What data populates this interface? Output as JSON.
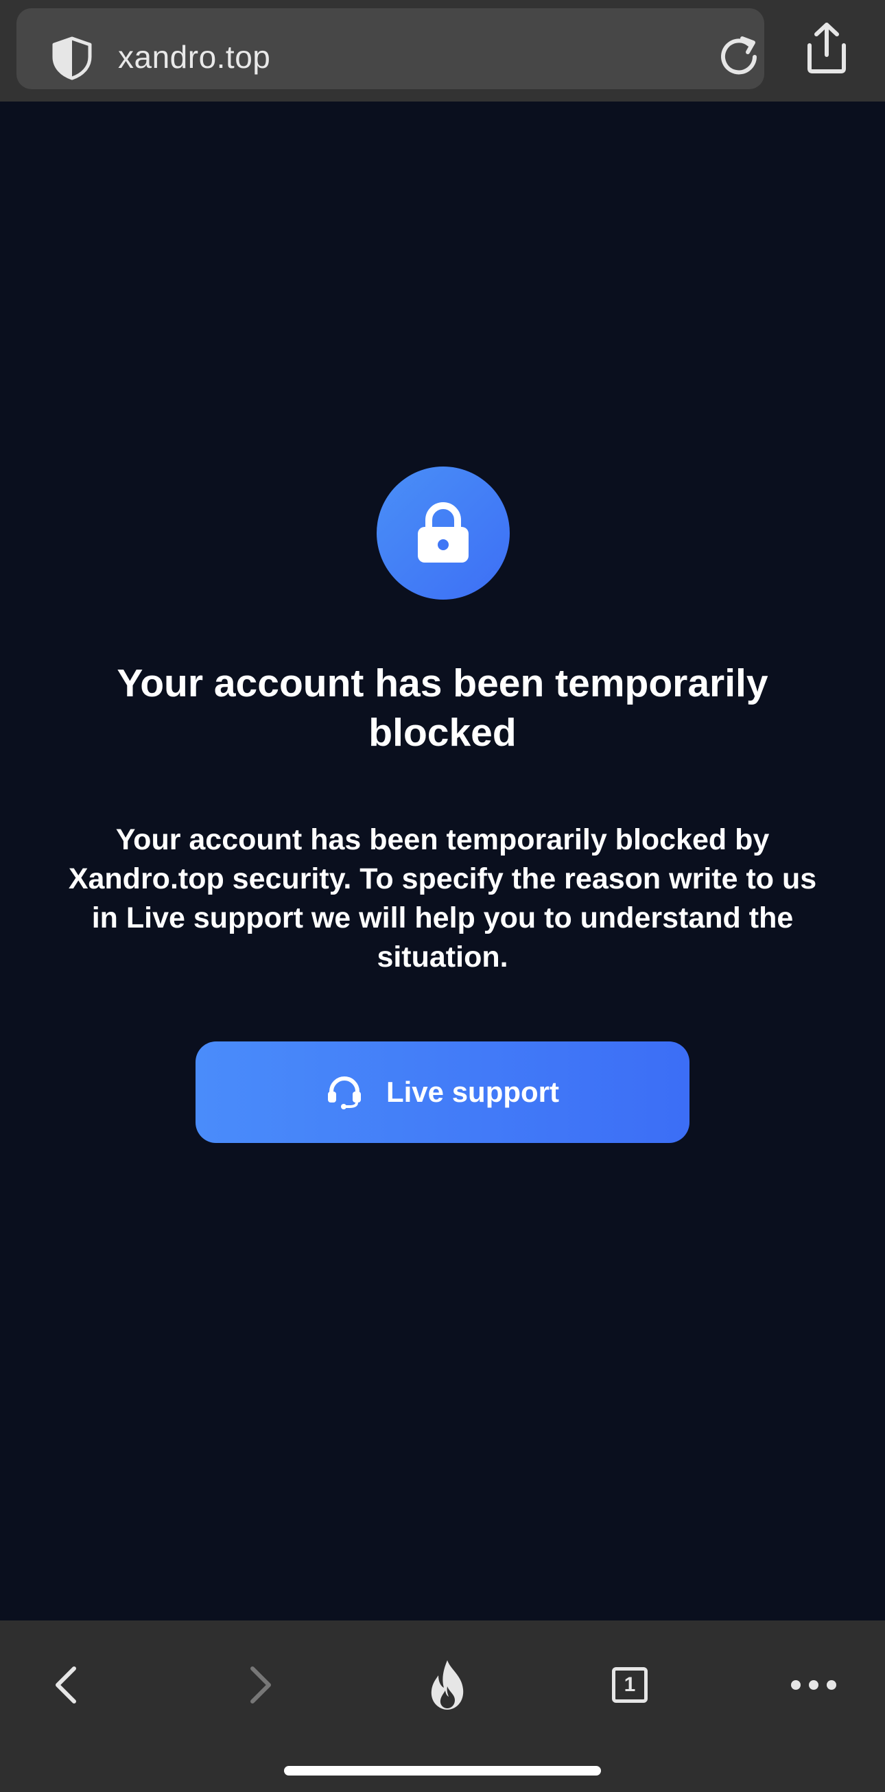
{
  "browser": {
    "url": "xandro.top",
    "icons": {
      "shield": "shield-icon",
      "reload": "reload-icon",
      "share": "share-icon"
    }
  },
  "page": {
    "heading": "Your account has been temporarily blocked",
    "description": "Your account has been temporarily blocked by Xandro.top security. To specify the reason write to us in Live support we will help you to understand the situation.",
    "support_button": {
      "label": "Live support",
      "icon": "headset-icon"
    },
    "lock_icon": "lock-icon"
  },
  "toolbar": {
    "tab_count": "1",
    "items": [
      "back-icon",
      "forward-icon",
      "fire-icon",
      "tabs-icon",
      "more-icon"
    ]
  },
  "colors": {
    "page_background": "#0a0f1e",
    "accent": "#4a8ff7",
    "accent_dark": "#3c6ef6",
    "top_bar": "#333333",
    "url_field": "#474747",
    "bottom_bar": "#2f2f2f"
  }
}
